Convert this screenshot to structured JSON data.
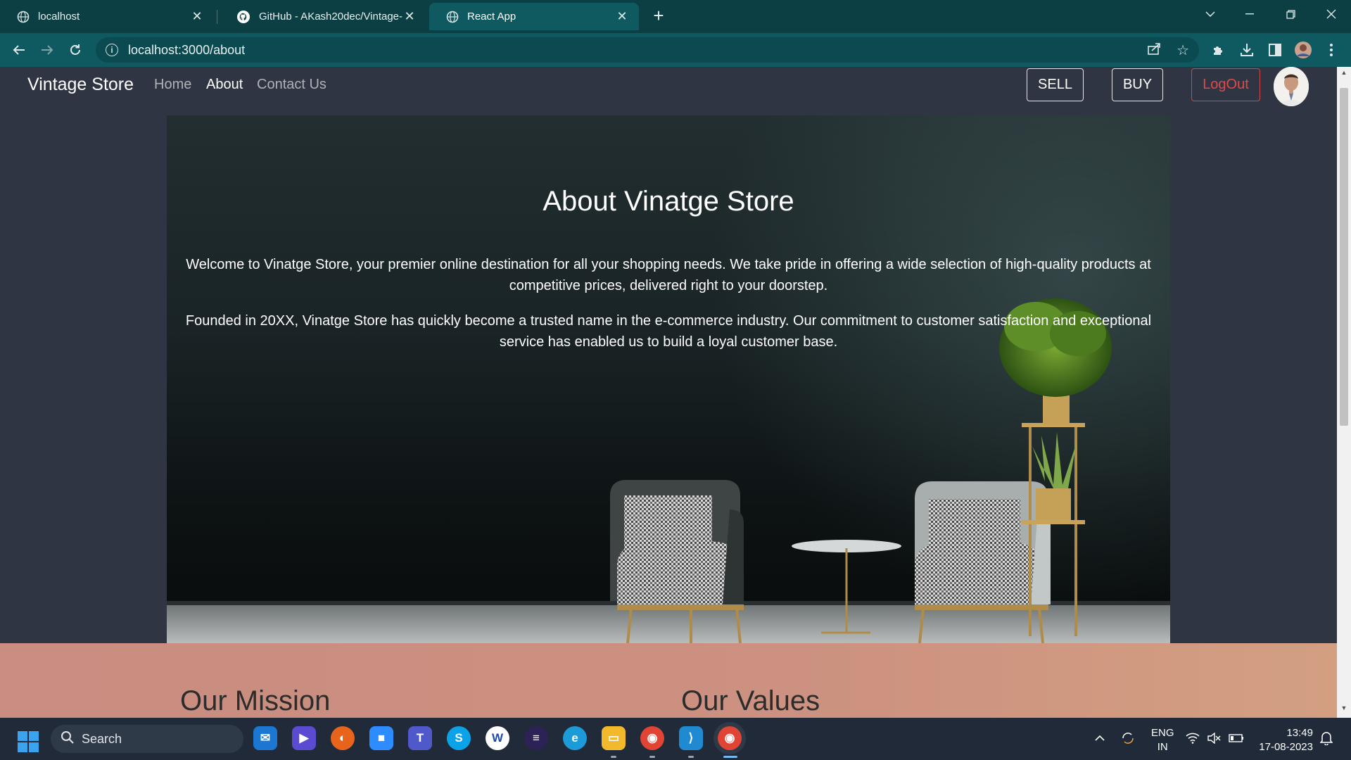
{
  "browser": {
    "tabs": [
      {
        "title": "localhost",
        "icon": "globe-icon",
        "active": false
      },
      {
        "title": "GitHub - AKash20dec/Vintage-St",
        "icon": "github-icon",
        "active": false
      },
      {
        "title": "React App",
        "icon": "globe-icon",
        "active": true
      }
    ],
    "url": "localhost:3000/about"
  },
  "navbar": {
    "brand": "Vintage Store",
    "links": [
      {
        "label": "Home",
        "active": false
      },
      {
        "label": "About",
        "active": true
      },
      {
        "label": "Contact Us",
        "active": false
      }
    ],
    "sell_label": "SELL",
    "buy_label": "BUY",
    "logout_label": "LogOut"
  },
  "hero": {
    "title": "About Vinatge Store",
    "paragraphs": [
      "Welcome to Vinatge Store, your premier online destination for all your shopping needs. We take pride in offering a wide selection of high-quality products at competitive prices, delivered right to your doorstep.",
      "Founded in 20XX, Vinatge Store has quickly become a trusted name in the e-commerce industry. Our commitment to customer satisfaction and exceptional service has enabled us to build a loyal customer base."
    ]
  },
  "sections": {
    "mission_title": "Our Mission",
    "values_title": "Our Values"
  },
  "taskbar": {
    "search_placeholder": "Search",
    "language": "ENG",
    "region": "IN",
    "time": "13:49",
    "date": "17-08-2023"
  },
  "colors": {
    "tab_bar": "#0b3f44",
    "toolbar": "#0e5a60",
    "navbar": "#2f3542",
    "logout": "#e24a4a",
    "lower_section": "#cc9180",
    "taskbar": "#202a38"
  }
}
